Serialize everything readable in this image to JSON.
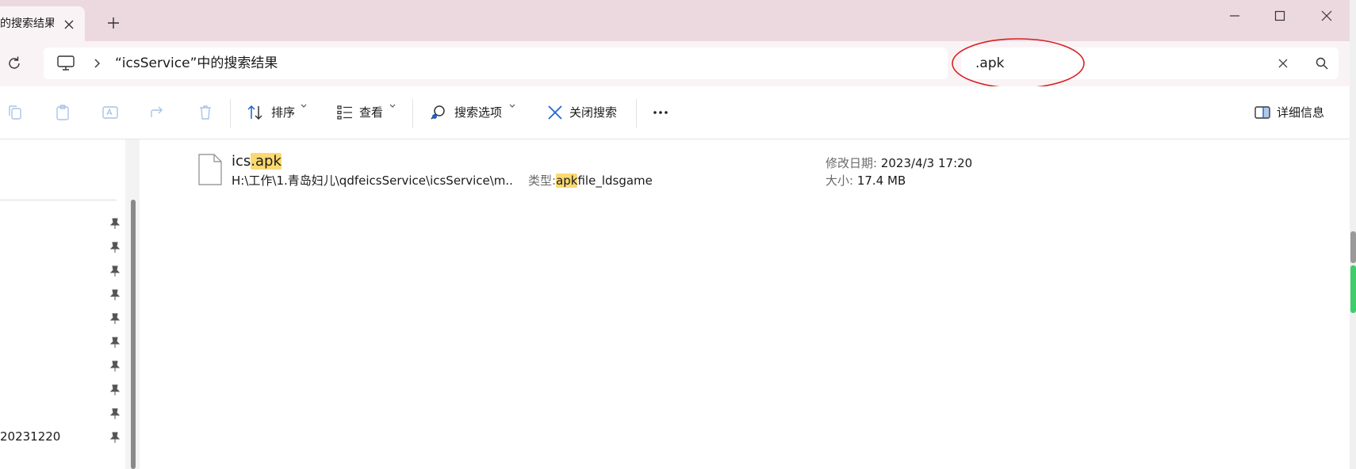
{
  "tab": {
    "title": "的搜索结果"
  },
  "address": {
    "location": "“icsService”中的搜索结果"
  },
  "search": {
    "query": ".apk"
  },
  "toolbar": {
    "sort_label": "排序",
    "view_label": "查看",
    "search_options_label": "搜索选项",
    "close_search_label": "关闭搜索",
    "details_label": "详细信息"
  },
  "nav": {
    "visible_item_label": "20231220"
  },
  "result": {
    "name_prefix": "ics",
    "name_match": ".apk",
    "path": "H:\\工作\\1.青岛妇儿\\qdfeicsService\\icsService\\m...",
    "type_label": "类型:",
    "type_match": "apk",
    "type_rest": "file_ldsgame",
    "date_label": "修改日期:",
    "date_value": "2023/4/3 17:20",
    "size_label": "大小:",
    "size_value": "17.4 MB"
  },
  "colors": {
    "titlebar_bg": "#ecd9df",
    "toolbar_accent": "#1a63c9",
    "highlight": "#fbd971",
    "annotation": "#d92020"
  }
}
